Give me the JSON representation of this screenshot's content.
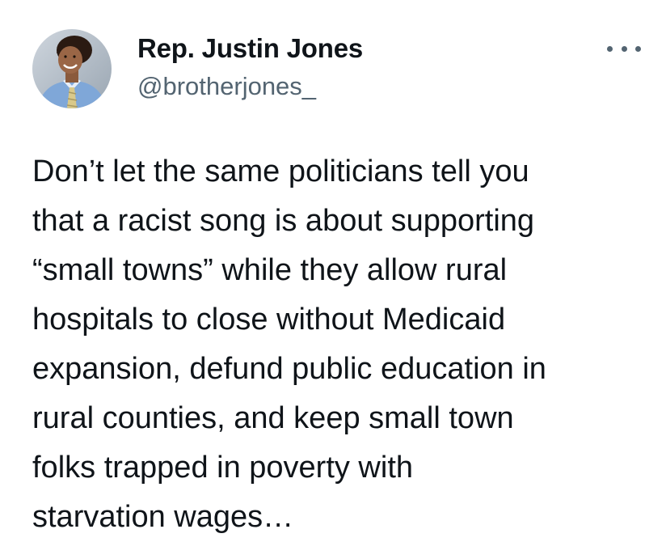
{
  "author": {
    "display_name": "Rep. Justin Jones",
    "handle": "@brotherjones_",
    "avatar_icon": "profile-photo"
  },
  "menu": {
    "icon": "more-horizontal-icon"
  },
  "tweet": {
    "lines": [
      "Don’t let the same politicians tell you",
      "that a racist song is about supporting",
      "“small towns” while they allow rural",
      "hospitals to close without Medicaid",
      "expansion, defund public education in",
      "rural counties, and keep small town",
      "folks trapped in poverty with",
      "starvation wages…"
    ]
  },
  "colors": {
    "text": "#0f1419",
    "secondary": "#536471",
    "background": "#ffffff"
  }
}
